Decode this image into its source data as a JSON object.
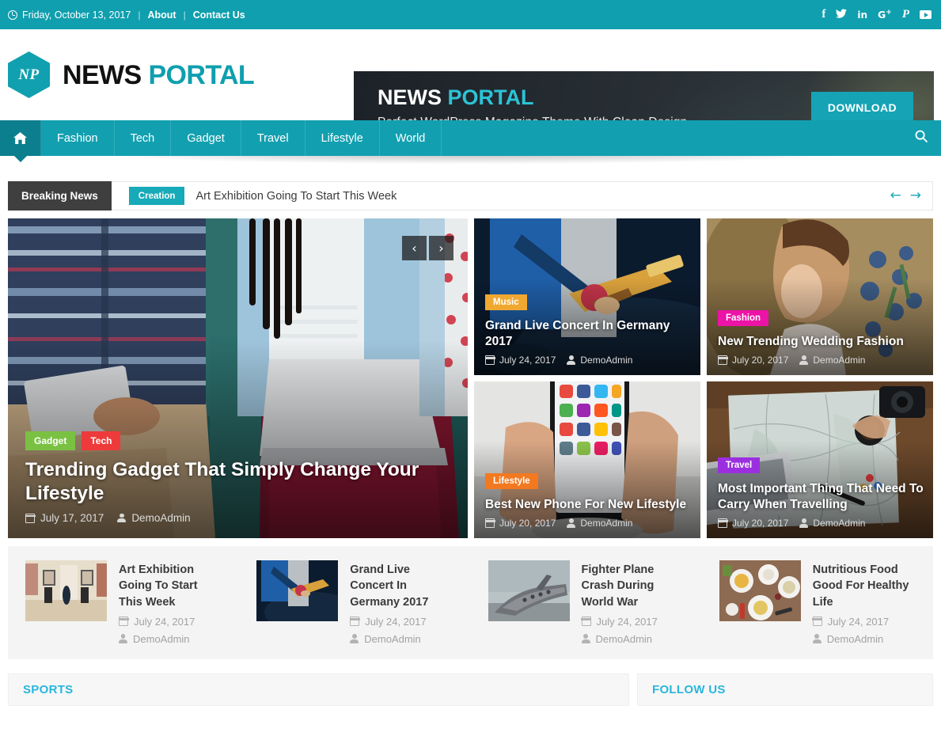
{
  "topbar": {
    "date": "Friday, October 13, 2017",
    "clock_icon": "clock-icon",
    "sep": "|",
    "links": [
      {
        "label": "About"
      },
      {
        "label": "Contact Us"
      }
    ],
    "socials": [
      {
        "name": "facebook-icon",
        "glyph": "f"
      },
      {
        "name": "twitter-icon",
        "glyph": "🐦"
      },
      {
        "name": "linkedin-icon",
        "glyph": "in"
      },
      {
        "name": "googleplus-icon",
        "glyph": "G+"
      },
      {
        "name": "pinterest-icon",
        "glyph": "𝑷"
      },
      {
        "name": "youtube-icon",
        "glyph": ""
      }
    ]
  },
  "header": {
    "logo_mark": "NP",
    "brand_first": "NEWS",
    "brand_second": " PORTAL",
    "banner": {
      "title_first": "NEWS",
      "title_second": " PORTAL",
      "subtitle": "Perfect  WordPress Magazine Theme With Clean Design",
      "button": "DOWNLOAD"
    }
  },
  "nav": {
    "home_icon": "home-icon",
    "items": [
      {
        "label": "Fashion"
      },
      {
        "label": "Tech"
      },
      {
        "label": "Gadget"
      },
      {
        "label": "Travel"
      },
      {
        "label": "Lifestyle"
      },
      {
        "label": "World"
      }
    ],
    "search_icon": "search-icon"
  },
  "breaking": {
    "label": "Breaking News",
    "category": "Creation",
    "headline": "Art Exhibition Going To Start This Week",
    "prev": "←",
    "next": "→"
  },
  "hero": {
    "badges": [
      {
        "label": "Gadget",
        "color": "#7ac143"
      },
      {
        "label": "Tech",
        "color": "#ee3a3a"
      }
    ],
    "title": "Trending Gadget That Simply Change Your Lifestyle",
    "date": "July 17, 2017",
    "author": "DemoAdmin",
    "prev": "‹",
    "next": "›"
  },
  "cards": [
    {
      "badge": "Music",
      "badge_color": "#f0a830",
      "title": "Grand Live Concert In Germany 2017",
      "date": "July 24, 2017",
      "author": "DemoAdmin"
    },
    {
      "badge": "Fashion",
      "badge_color": "#ec13a7",
      "title": "New Trending Wedding Fashion",
      "date": "July 20, 2017",
      "author": "DemoAdmin"
    },
    {
      "badge": "Lifestyle",
      "badge_color": "#f37920",
      "title": "Best New Phone For New Lifestyle",
      "date": "July 20, 2017",
      "author": "DemoAdmin"
    },
    {
      "badge": "Travel",
      "badge_color": "#9b2fe0",
      "title": "Most Important Thing That Need To Carry When Travelling",
      "date": "July 20, 2017",
      "author": "DemoAdmin"
    }
  ],
  "strip": [
    {
      "title": "Art Exhibition Going To Start This Week",
      "date": "July 24, 2017",
      "author": "DemoAdmin"
    },
    {
      "title": "Grand Live Concert In Germany 2017",
      "date": "July 24, 2017",
      "author": "DemoAdmin"
    },
    {
      "title": "Fighter Plane Crash During World War",
      "date": "July 24, 2017",
      "author": "DemoAdmin"
    },
    {
      "title": "Nutritious Food Good For Healthy Life",
      "date": "July 24, 2017",
      "author": "DemoAdmin"
    }
  ],
  "bottom": {
    "sports": "SPORTS",
    "follow": "FOLLOW US"
  },
  "colors": {
    "teal": "#0f9fae",
    "teal_dark": "#0b7f8d",
    "accent_blue": "#29b6dd",
    "dark": "#3f3f3f"
  }
}
